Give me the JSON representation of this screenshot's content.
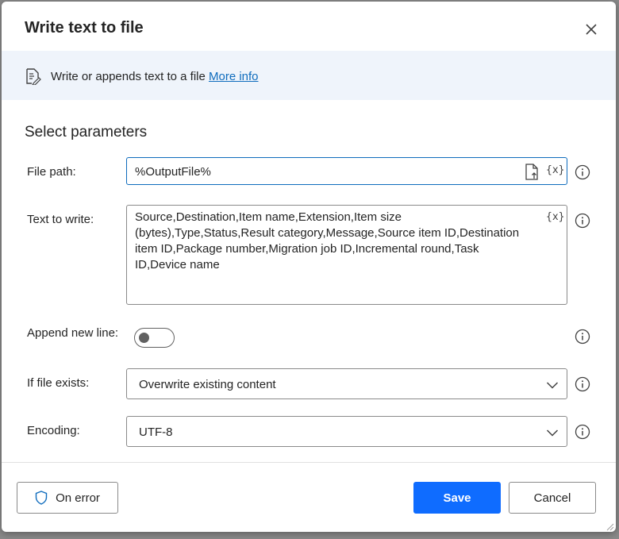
{
  "dialog": {
    "title": "Write text to file",
    "banner": {
      "text": "Write or appends text to a file",
      "link": "More info"
    },
    "section_title": "Select parameters",
    "fields": {
      "file_path": {
        "label": "File path:",
        "value": "%OutputFile%",
        "var_button": "{x}"
      },
      "text_to_write": {
        "label": "Text to write:",
        "value": "Source,Destination,Item name,Extension,Item size (bytes),Type,Status,Result category,Message,Source item ID,Destination item ID,Package number,Migration job ID,Incremental round,Task ID,Device name",
        "var_button": "{x}"
      },
      "append_new_line": {
        "label": "Append new line:",
        "state": "off"
      },
      "if_file_exists": {
        "label": "If file exists:",
        "value": "Overwrite existing content"
      },
      "encoding": {
        "label": "Encoding:",
        "value": "UTF-8"
      }
    },
    "footer": {
      "on_error": "On error",
      "save": "Save",
      "cancel": "Cancel"
    },
    "colors": {
      "accent": "#0f6cff",
      "link": "#0f6cbd",
      "banner_bg": "#eff4fb"
    }
  }
}
